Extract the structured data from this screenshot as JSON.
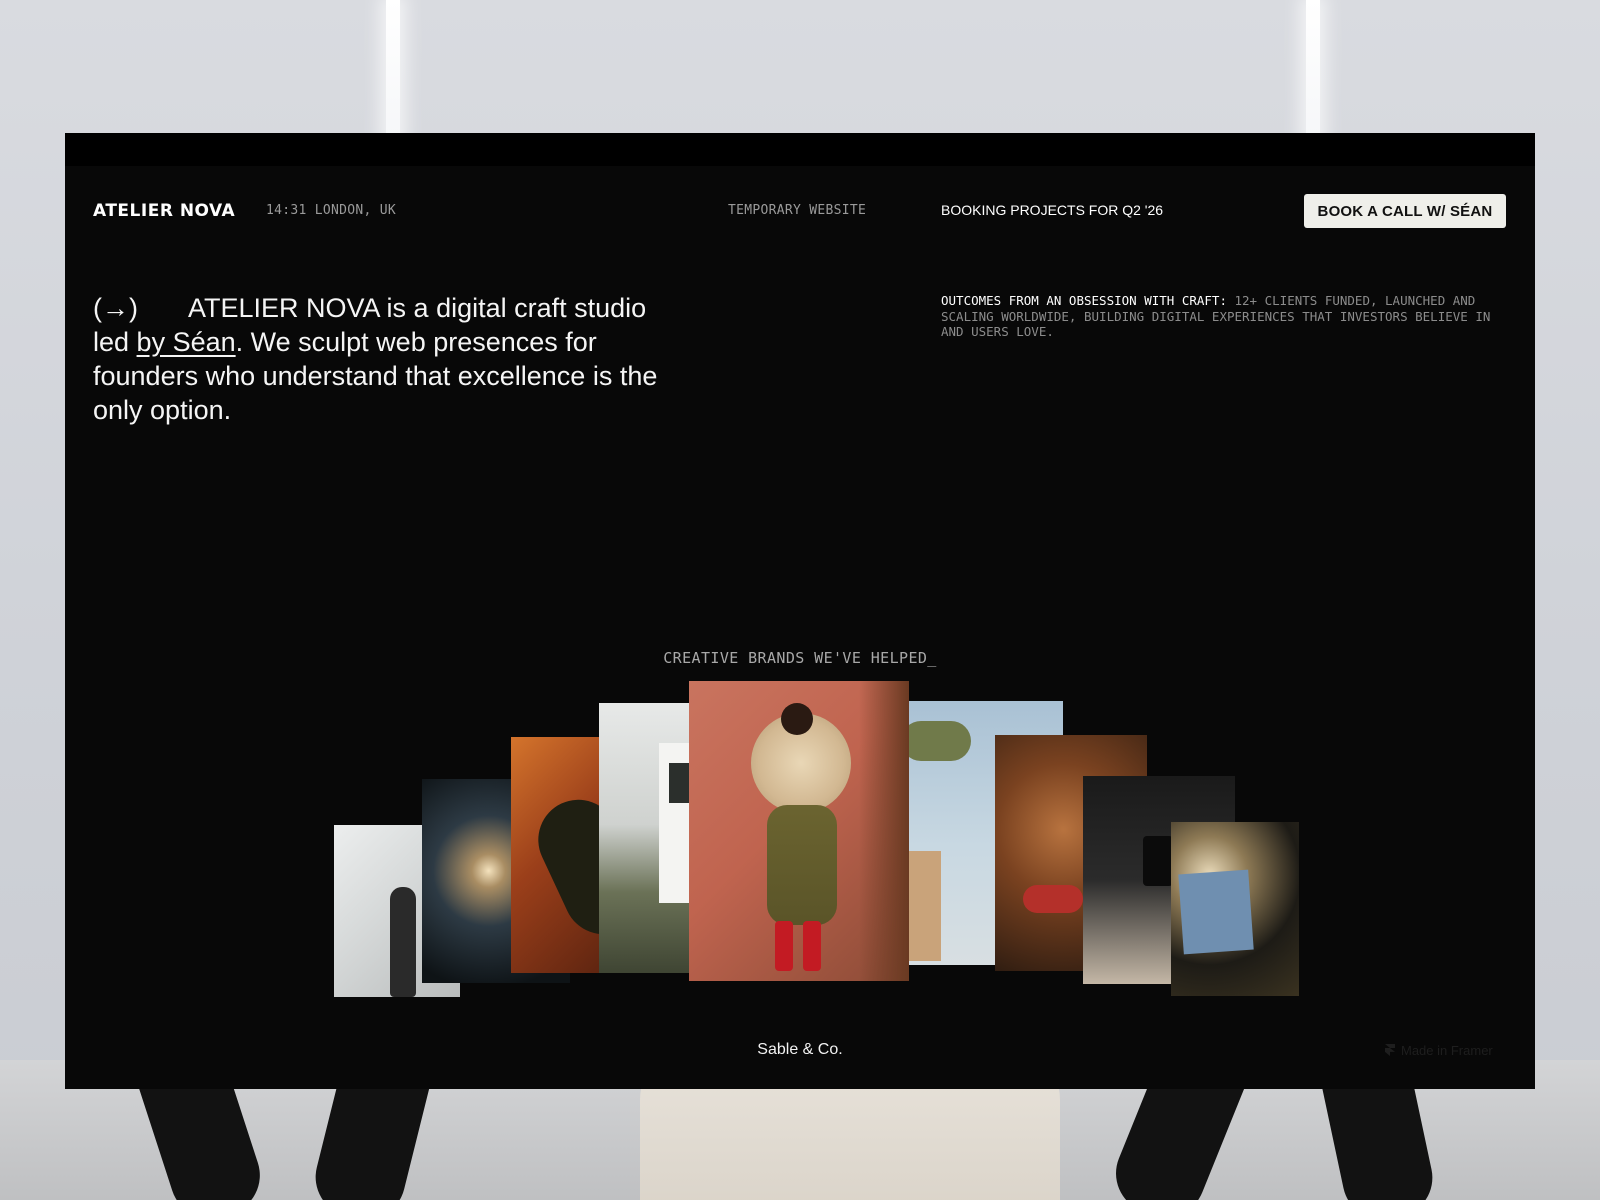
{
  "header": {
    "logo": "ATELIER NOVA",
    "clock": "14:31 LONDON, UK",
    "temporary_label": "TEMPORARY WEBSITE",
    "booking_status": "BOOKING PROJECTS FOR Q2 '26",
    "cta_label": "BOOK A CALL W/ SÉAN"
  },
  "intro": {
    "arrow": "(→)",
    "text_before_link": "ATELIER NOVA is a digital craft studio led ",
    "link_text": "by Séan",
    "text_after_link": ". We sculpt web presences for founders who understand that excellence is the only option."
  },
  "outcomes": {
    "lead": "OUTCOMES FROM AN OBSESSION WITH CRAFT:",
    "body": " 12+ CLIENTS FUNDED, LAUNCHED AND SCALING WORLDWIDE, BUILDING DIGITAL EXPERIENCES THAT INVESTORS BELIEVE IN AND USERS LOVE."
  },
  "brands": {
    "title": "CREATIVE BRANDS WE'VE HELPED_",
    "active_caption": "Sable & Co."
  },
  "footer": {
    "badge": "Made in Framer"
  },
  "colors": {
    "page_background": "#080808",
    "text_primary": "#f5f5f5",
    "text_muted": "#9a9a9a",
    "cta_background": "#efefea",
    "cta_text": "#111111"
  },
  "icons": {
    "arrow": "right-arrow-icon",
    "framer": "framer-logo-icon"
  }
}
